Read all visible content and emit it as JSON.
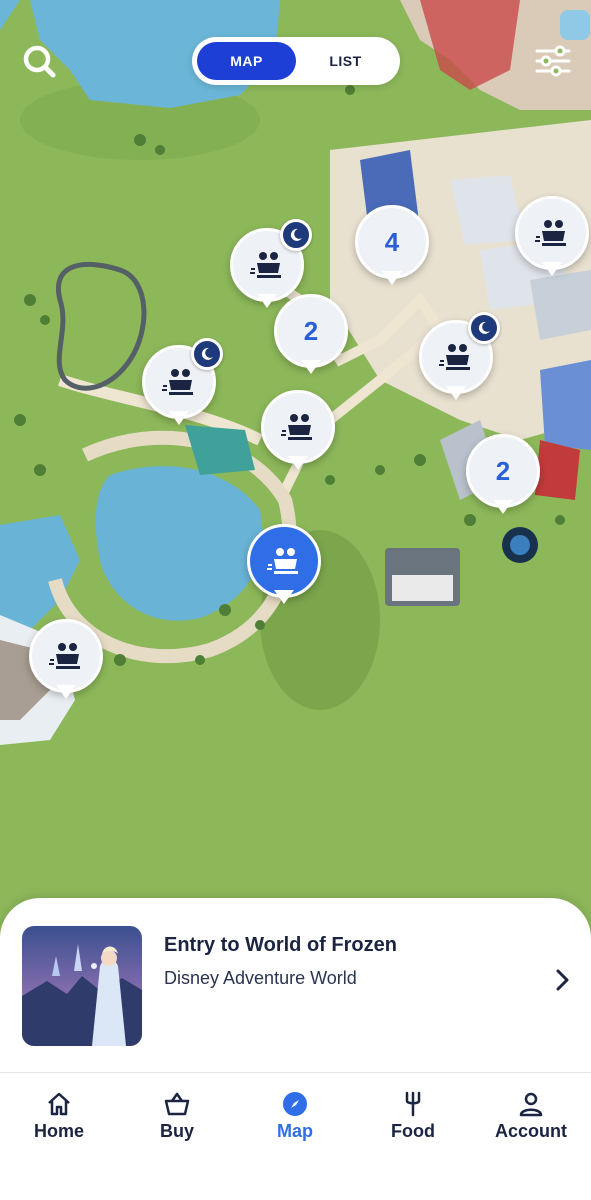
{
  "header": {
    "toggle": {
      "map_label": "MAP",
      "list_label": "LIST",
      "selected": "MAP"
    }
  },
  "map": {
    "pins": [
      {
        "id": "ride-cluster-a",
        "type": "ride",
        "has_night_badge": true
      },
      {
        "id": "count-4",
        "type": "cluster",
        "count": "4"
      },
      {
        "id": "ride-top-right",
        "type": "ride",
        "has_night_badge": false
      },
      {
        "id": "count-2-center",
        "type": "cluster",
        "count": "2"
      },
      {
        "id": "ride-left",
        "type": "ride",
        "has_night_badge": true
      },
      {
        "id": "ride-right",
        "type": "ride",
        "has_night_badge": true
      },
      {
        "id": "ride-center",
        "type": "ride",
        "has_night_badge": false
      },
      {
        "id": "count-2-right",
        "type": "cluster",
        "count": "2"
      },
      {
        "id": "ride-selected",
        "type": "ride",
        "selected": true
      },
      {
        "id": "ride-bottom-left",
        "type": "ride",
        "has_night_badge": false
      }
    ]
  },
  "card": {
    "title": "Entry to World of Frozen",
    "subtitle": "Disney Adventure World",
    "thumbnail_icon": "frozen-attraction-thumbnail",
    "chevron_icon": "chevron-right-icon"
  },
  "nav": {
    "items": [
      {
        "label": "Home",
        "icon": "home-icon"
      },
      {
        "label": "Buy",
        "icon": "basket-icon"
      },
      {
        "label": "Map",
        "icon": "compass-icon",
        "active": true
      },
      {
        "label": "Food",
        "icon": "fork-icon"
      },
      {
        "label": "Account",
        "icon": "person-icon"
      }
    ]
  },
  "colors": {
    "accent": "#1d3fd6",
    "pin_selected": "#2f6ee6",
    "pin_count": "#2a5fd8",
    "night_badge": "#1f3a7a",
    "map_grass": "#8fb85c",
    "water": "#6bb6d8",
    "text_dark": "#1b2440"
  }
}
